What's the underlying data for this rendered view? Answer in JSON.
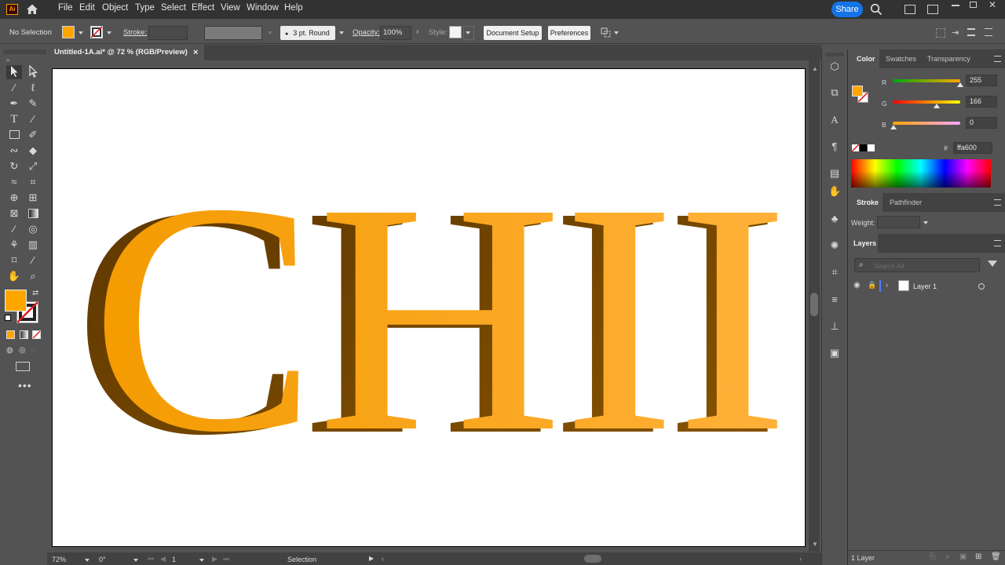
{
  "app": {
    "logo": "Ai",
    "share_label": "Share"
  },
  "menu": [
    "File",
    "Edit",
    "Object",
    "Type",
    "Select",
    "Effect",
    "View",
    "Window",
    "Help"
  ],
  "control_bar": {
    "selection_status": "No Selection",
    "stroke_label": "Stroke:",
    "brush_label": "3 pt. Round",
    "opacity_label": "Opacity:",
    "opacity_value": "100%",
    "style_label": "Style:",
    "document_setup": "Document Setup",
    "preferences": "Preferences"
  },
  "document_tab": {
    "title": "Untitled-1A.ai* @ 72 % (RGB/Preview)",
    "close": "×"
  },
  "artwork": {
    "text": "CHII",
    "fill_color": "#ffa600",
    "shadow_color": "#6b4200"
  },
  "color_panel": {
    "tabs": [
      "Color",
      "Swatches",
      "Transparency"
    ],
    "r_label": "R",
    "r_value": "255",
    "g_label": "G",
    "g_value": "166",
    "b_label": "B",
    "b_value": "0",
    "hex_symbol": "#",
    "hex_value": "ffa600"
  },
  "stroke_panel": {
    "tabs": [
      "Stroke",
      "Pathfinder"
    ],
    "weight_label": "Weight:"
  },
  "layers_panel": {
    "title": "Layers",
    "search_placeholder": "Search All",
    "layer_name": "Layer 1",
    "footer_count": "1 Layer"
  },
  "status_bar": {
    "zoom": "72%",
    "rotation": "0°",
    "artboard": "1",
    "tool": "Selection"
  },
  "colors": {
    "fill": "#ffa600",
    "accent": "#1473e6"
  }
}
